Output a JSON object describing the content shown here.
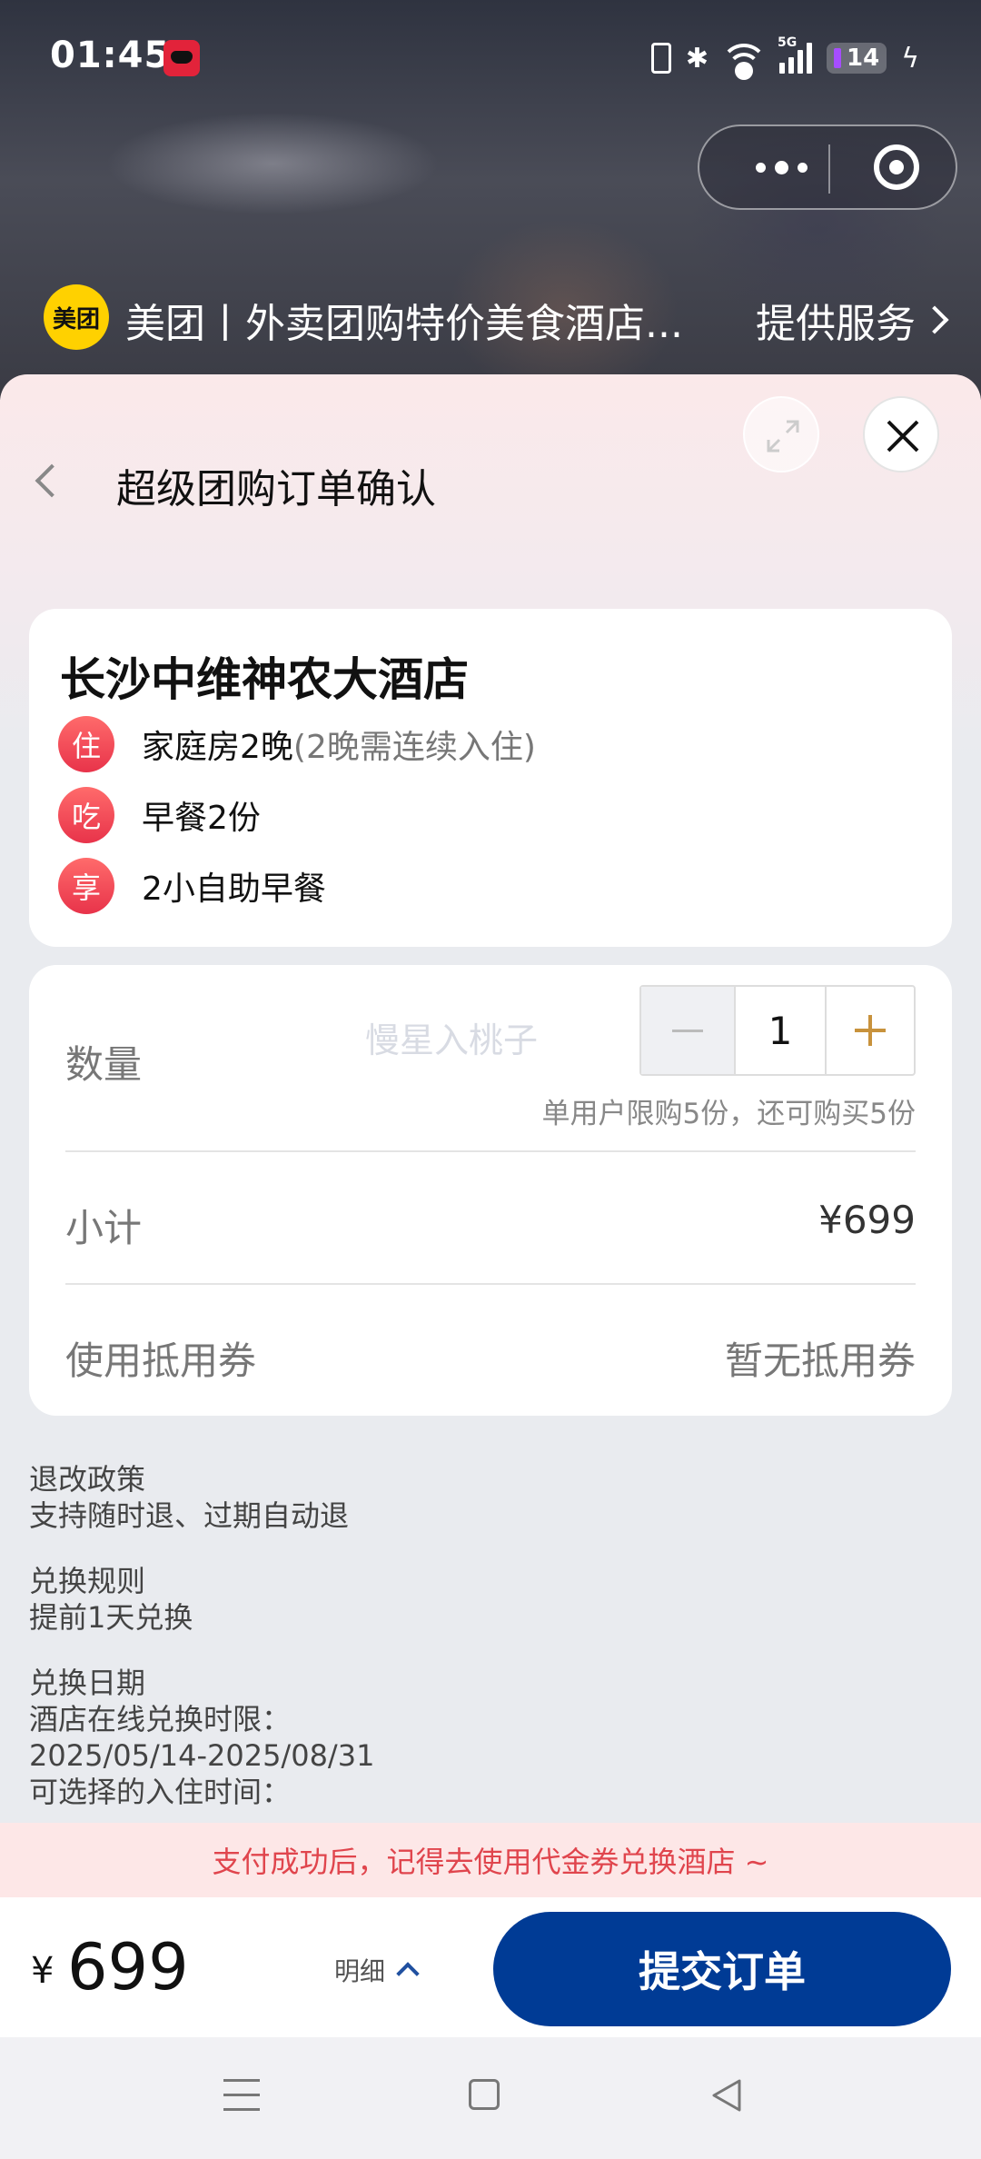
{
  "status_bar": {
    "time": "01:45",
    "battery": "14",
    "network": "5G"
  },
  "service_bar": {
    "logo": "美团",
    "title": "美团丨外卖团购特价美食酒店...",
    "link": "提供服务"
  },
  "page": {
    "title": "超级团购订单确认"
  },
  "hotel": {
    "name": "长沙中维神农大酒店",
    "items": [
      {
        "badge": "住",
        "text": "家庭房2晚",
        "note": "(2晚需连续入住)"
      },
      {
        "badge": "吃",
        "text": "早餐2份",
        "note": ""
      },
      {
        "badge": "享",
        "text": "2小自助早餐",
        "note": ""
      }
    ]
  },
  "order": {
    "quantity_label": "数量",
    "watermark": "慢星入桃子",
    "quantity": "1",
    "limit_text": "单用户限购5份，还可购买5份",
    "subtotal_label": "小计",
    "subtotal_value": "¥699",
    "coupon_label": "使用抵用券",
    "coupon_value": "暂无抵用券"
  },
  "policies": [
    {
      "title": "退改政策",
      "lines": [
        "支持随时退、过期自动退"
      ]
    },
    {
      "title": "兑换规则",
      "lines": [
        "提前1天兑换"
      ]
    },
    {
      "title": "兑换日期",
      "lines": [
        "酒店在线兑换时限：",
        "2025/05/14-2025/08/31",
        "可选择的入住时间："
      ]
    }
  ],
  "tip": "支付成功后，记得去使用代金券兑换酒店 ~",
  "bottom": {
    "currency": "¥",
    "price": "699",
    "detail_label": "明细",
    "submit_label": "提交订单"
  },
  "colors": {
    "accent": "#003b95",
    "badge": "#e8334a",
    "plus": "#c8923c",
    "tip_text": "#e0454d",
    "tip_bg": "#fde7e7",
    "meituan_yellow": "#ffd100"
  },
  "icons": [
    "back-icon",
    "expand-icon",
    "close-icon",
    "more-icon",
    "mini-program-close-icon",
    "chevron-right-icon",
    "chevron-up-icon",
    "minus-icon",
    "plus-icon"
  ]
}
